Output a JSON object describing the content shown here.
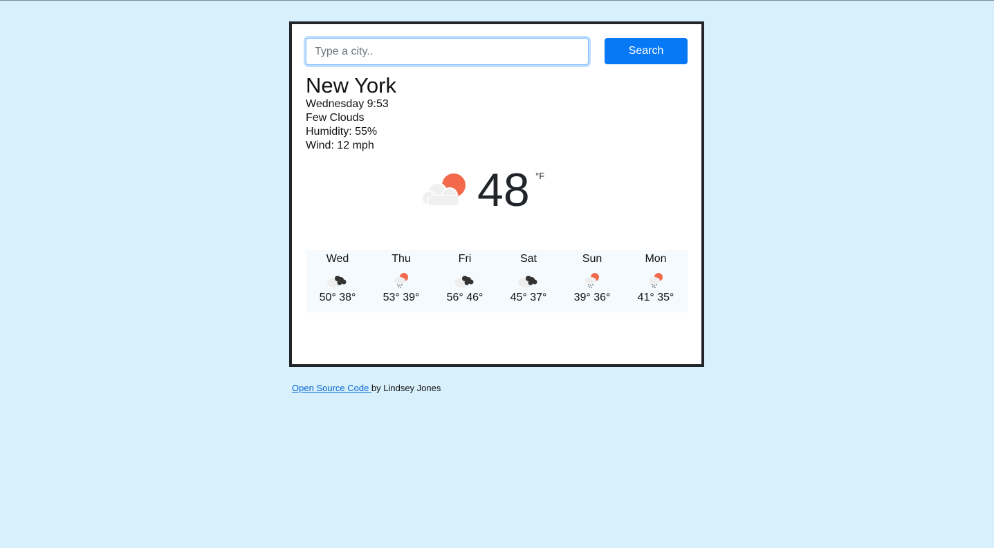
{
  "search": {
    "placeholder": "Type a city..",
    "value": "",
    "button_label": "Search"
  },
  "current": {
    "city": "New York",
    "datetime": "Wednesday 9:53",
    "description": "Few Clouds",
    "humidity": "Humidity: 55%",
    "wind": "Wind: 12 mph",
    "temperature": "48",
    "unit": "°F",
    "icon": "few-clouds-icon"
  },
  "forecast": [
    {
      "day": "Wed",
      "temps": "50° 38°",
      "icon": "broken-clouds-icon"
    },
    {
      "day": "Thu",
      "temps": "53° 39°",
      "icon": "rain-sun-icon"
    },
    {
      "day": "Fri",
      "temps": "56° 46°",
      "icon": "broken-clouds-icon"
    },
    {
      "day": "Sat",
      "temps": "45° 37°",
      "icon": "broken-clouds-icon"
    },
    {
      "day": "Sun",
      "temps": "39° 36°",
      "icon": "rain-sun-icon"
    },
    {
      "day": "Mon",
      "temps": "41° 35°",
      "icon": "rain-sun-icon"
    }
  ],
  "footer": {
    "link_text": "Open Source Code ",
    "suffix": "by Lindsey Jones"
  },
  "colors": {
    "background": "#d8effc",
    "button": "#0779f6",
    "sun": "#f26a4b",
    "cloud": "#f0f0f0",
    "dark_cloud": "#333333",
    "link": "#0366d6"
  }
}
